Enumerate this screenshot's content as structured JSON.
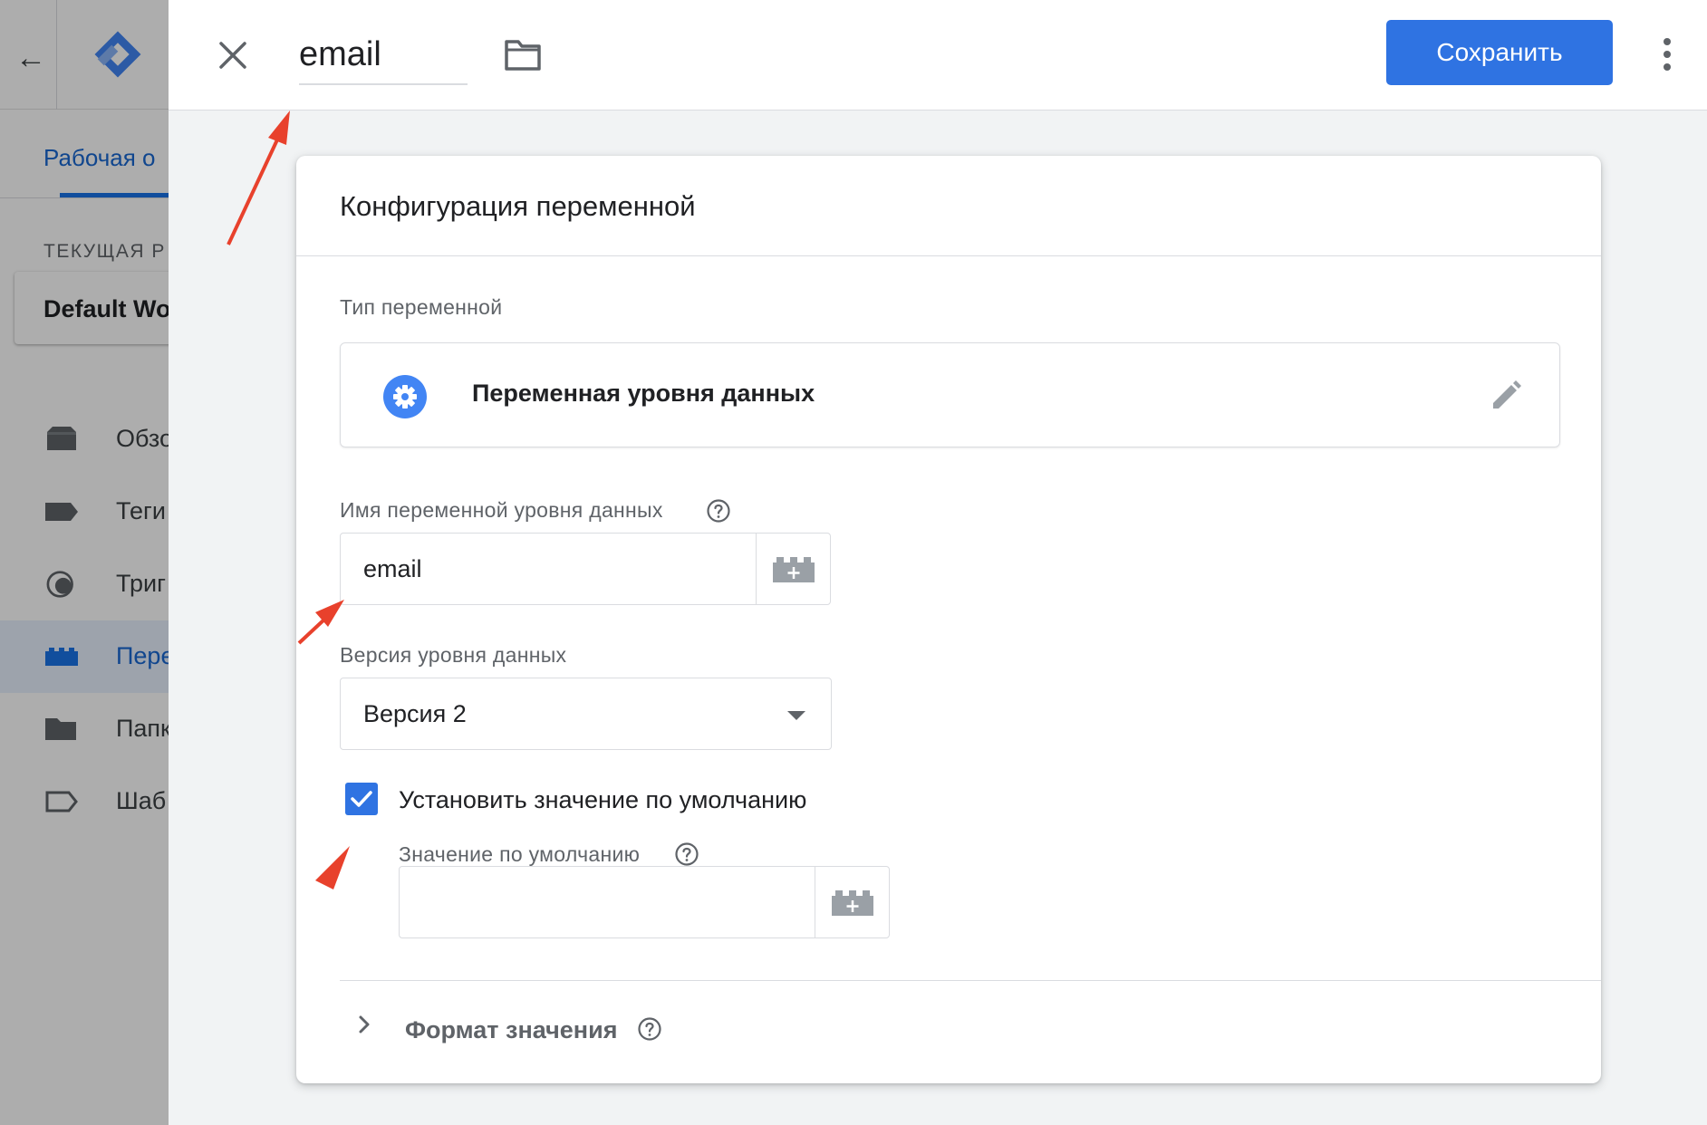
{
  "background_app": {
    "tab_label": "Рабочая о",
    "workspace_section_label": "ТЕКУЩАЯ Р",
    "workspace_name": "Default Wo",
    "nav_items": [
      {
        "label": "Обзо",
        "icon": "overview-icon"
      },
      {
        "label": "Теги",
        "icon": "tag-icon"
      },
      {
        "label": "Триг",
        "icon": "trigger-icon"
      },
      {
        "label": "Пере",
        "icon": "variable-icon",
        "active": true
      },
      {
        "label": "Папк",
        "icon": "folder-icon"
      },
      {
        "label": "Шаб",
        "icon": "template-icon"
      }
    ]
  },
  "topbar": {
    "variable_name": "email",
    "save_label": "Сохранить",
    "icons": [
      "close-icon",
      "folder-icon",
      "more-vert-icon"
    ]
  },
  "card": {
    "title": "Конфигурация переменной",
    "type_section_label": "Тип переменной",
    "type_name": "Переменная уровня данных",
    "datalayer_name_label": "Имя переменной уровня данных",
    "datalayer_name_value": "email",
    "version_label": "Версия уровня данных",
    "version_value": "Версия 2",
    "default_checkbox_label": "Установить значение по умолчанию",
    "default_checkbox_checked": true,
    "default_value_label": "Значение по умолчанию",
    "default_value": "",
    "format_section_label": "Формат значения"
  },
  "colors": {
    "accent": "#2f73e2",
    "annotation_arrow": "#e8412c"
  }
}
